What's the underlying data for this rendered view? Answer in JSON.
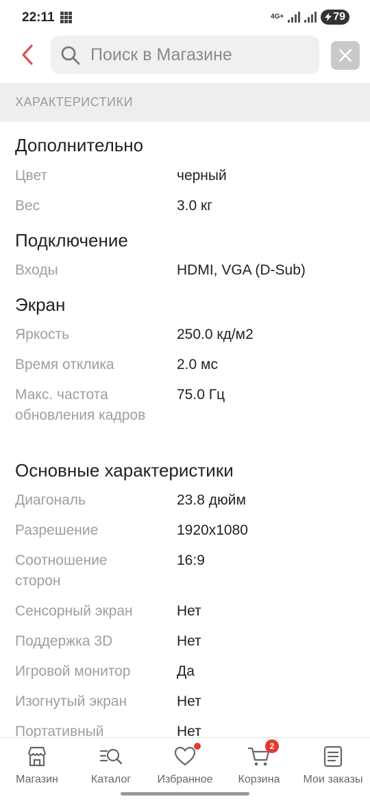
{
  "status_bar": {
    "time": "22:11",
    "network": "4G+",
    "battery": "79"
  },
  "header": {
    "search_placeholder": "Поиск в Магазине"
  },
  "section": {
    "title": "ХАРАКТЕРИСТИКИ"
  },
  "groups": [
    {
      "title": "Дополнительно",
      "specs": [
        {
          "label": "Цвет",
          "value": "черный"
        },
        {
          "label": "Вес",
          "value": "3.0 кг"
        }
      ]
    },
    {
      "title": "Подключение",
      "specs": [
        {
          "label": "Входы",
          "value": "HDMI, VGA (D-Sub)"
        }
      ]
    },
    {
      "title": "Экран",
      "specs": [
        {
          "label": "Яркость",
          "value": "250.0 кд/м2"
        },
        {
          "label": "Время отклика",
          "value": "2.0 мс"
        },
        {
          "label": "Макс. частота обновления кадров",
          "value": "75.0 Гц"
        }
      ]
    },
    {
      "title": "Основные характеристики",
      "specs": [
        {
          "label": "Диагональ",
          "value": "23.8 дюйм"
        },
        {
          "label": "Разрешение",
          "value": "1920x1080"
        },
        {
          "label": "Соотношение сторон",
          "value": "16:9"
        },
        {
          "label": "Сенсорный экран",
          "value": "Нет"
        },
        {
          "label": "Поддержка 3D",
          "value": "Нет"
        },
        {
          "label": "Игровой монитор",
          "value": "Да"
        },
        {
          "label": "Изогнутый экран",
          "value": "Нет"
        },
        {
          "label": "Портативный",
          "value": "Нет"
        }
      ]
    }
  ],
  "bottom_nav": {
    "items": [
      {
        "label": "Магазин",
        "icon": "store-icon"
      },
      {
        "label": "Каталог",
        "icon": "catalog-search-icon"
      },
      {
        "label": "Избранное",
        "icon": "heart-icon"
      },
      {
        "label": "Корзина",
        "icon": "cart-icon",
        "badge": "2"
      },
      {
        "label": "Мои заказы",
        "icon": "orders-list-icon"
      }
    ]
  },
  "colors": {
    "accent": "#e53935",
    "back_arrow": "#d9534f",
    "section_bg": "#eeeeee",
    "label_gray": "#9e9e9e"
  }
}
